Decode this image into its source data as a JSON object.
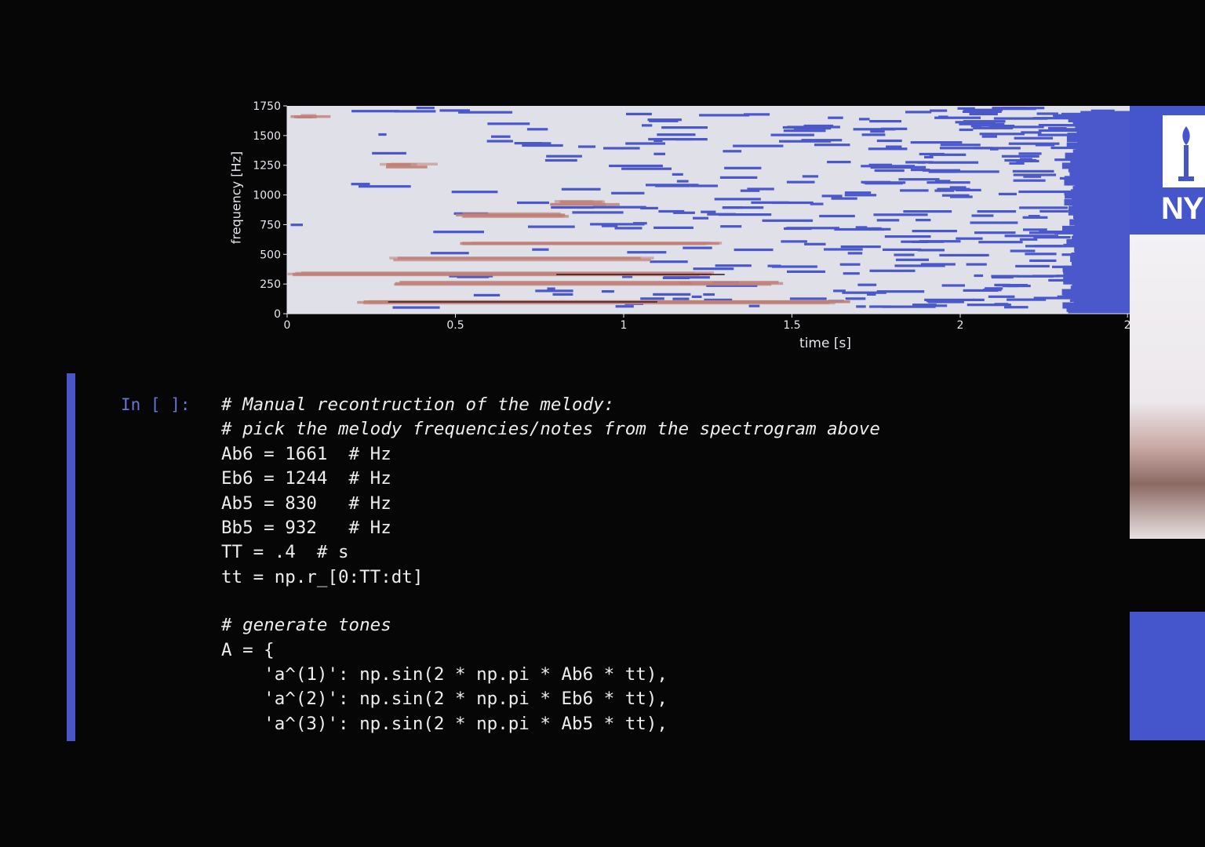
{
  "figure": {
    "ylabel": "frequency [Hz]",
    "xlabel": "time [s]"
  },
  "chart_data": {
    "type": "heatmap",
    "title": "",
    "xlabel": "time [s]",
    "ylabel": "frequency [Hz]",
    "x_ticks": [
      "0",
      "0.5",
      "1",
      "1.5",
      "2",
      "2"
    ],
    "y_ticks": [
      "0",
      "250",
      "500",
      "750",
      "1000",
      "1250",
      "1500",
      "1750"
    ],
    "xlim": [
      0,
      2.5
    ],
    "ylim": [
      0,
      1750
    ],
    "colors": {
      "background": "#e0e0e8",
      "low_energy": "#4a58cc",
      "high_energy": "#c08078",
      "peak": "#3a1e1e"
    },
    "harmonic_tracks_hz": [
      {
        "freq": 1661,
        "t_start": 0.0,
        "t_end": 0.15,
        "level": "high"
      },
      {
        "freq": 1244,
        "t_start": 0.27,
        "t_end": 0.45,
        "level": "high"
      },
      {
        "freq": 830,
        "t_start": 0.5,
        "t_end": 0.9,
        "level": "high"
      },
      {
        "freq": 932,
        "t_start": 0.78,
        "t_end": 1.0,
        "level": "high"
      },
      {
        "freq": 580,
        "t_start": 0.5,
        "t_end": 1.3,
        "level": "high"
      },
      {
        "freq": 460,
        "t_start": 0.3,
        "t_end": 1.1,
        "level": "medium"
      },
      {
        "freq": 330,
        "t_start": 0.0,
        "t_end": 1.3,
        "level": "high"
      },
      {
        "freq": 250,
        "t_start": 0.3,
        "t_end": 1.5,
        "level": "medium"
      },
      {
        "freq": 100,
        "t_start": 0.2,
        "t_end": 1.7,
        "level": "high"
      }
    ]
  },
  "notebook": {
    "prompt": "In [ ]:",
    "code_lines": [
      {
        "text": "# Manual recontruction of the melody:",
        "comment": true
      },
      {
        "text": "# pick the melody frequencies/notes from the spectrogram above",
        "comment": true
      },
      {
        "text": "Ab6 = 1661  # Hz",
        "comment": false
      },
      {
        "text": "Eb6 = 1244  # Hz",
        "comment": false
      },
      {
        "text": "Ab5 = 830   # Hz",
        "comment": false
      },
      {
        "text": "Bb5 = 932   # Hz",
        "comment": false
      },
      {
        "text": "TT = .4  # s",
        "comment": false
      },
      {
        "text": "tt = np.r_[0:TT:dt]",
        "comment": false
      },
      {
        "text": "",
        "comment": false
      },
      {
        "text": "# generate tones",
        "comment": true
      },
      {
        "text": "A = {",
        "comment": false
      },
      {
        "text": "    'a^(1)': np.sin(2 * np.pi * Ab6 * tt),",
        "comment": false
      },
      {
        "text": "    'a^(2)': np.sin(2 * np.pi * Eb6 * tt),",
        "comment": false
      },
      {
        "text": "    'a^(3)': np.sin(2 * np.pi * Ab5 * tt),",
        "comment": false
      }
    ]
  },
  "side_panel": {
    "logo_text": "NY"
  }
}
